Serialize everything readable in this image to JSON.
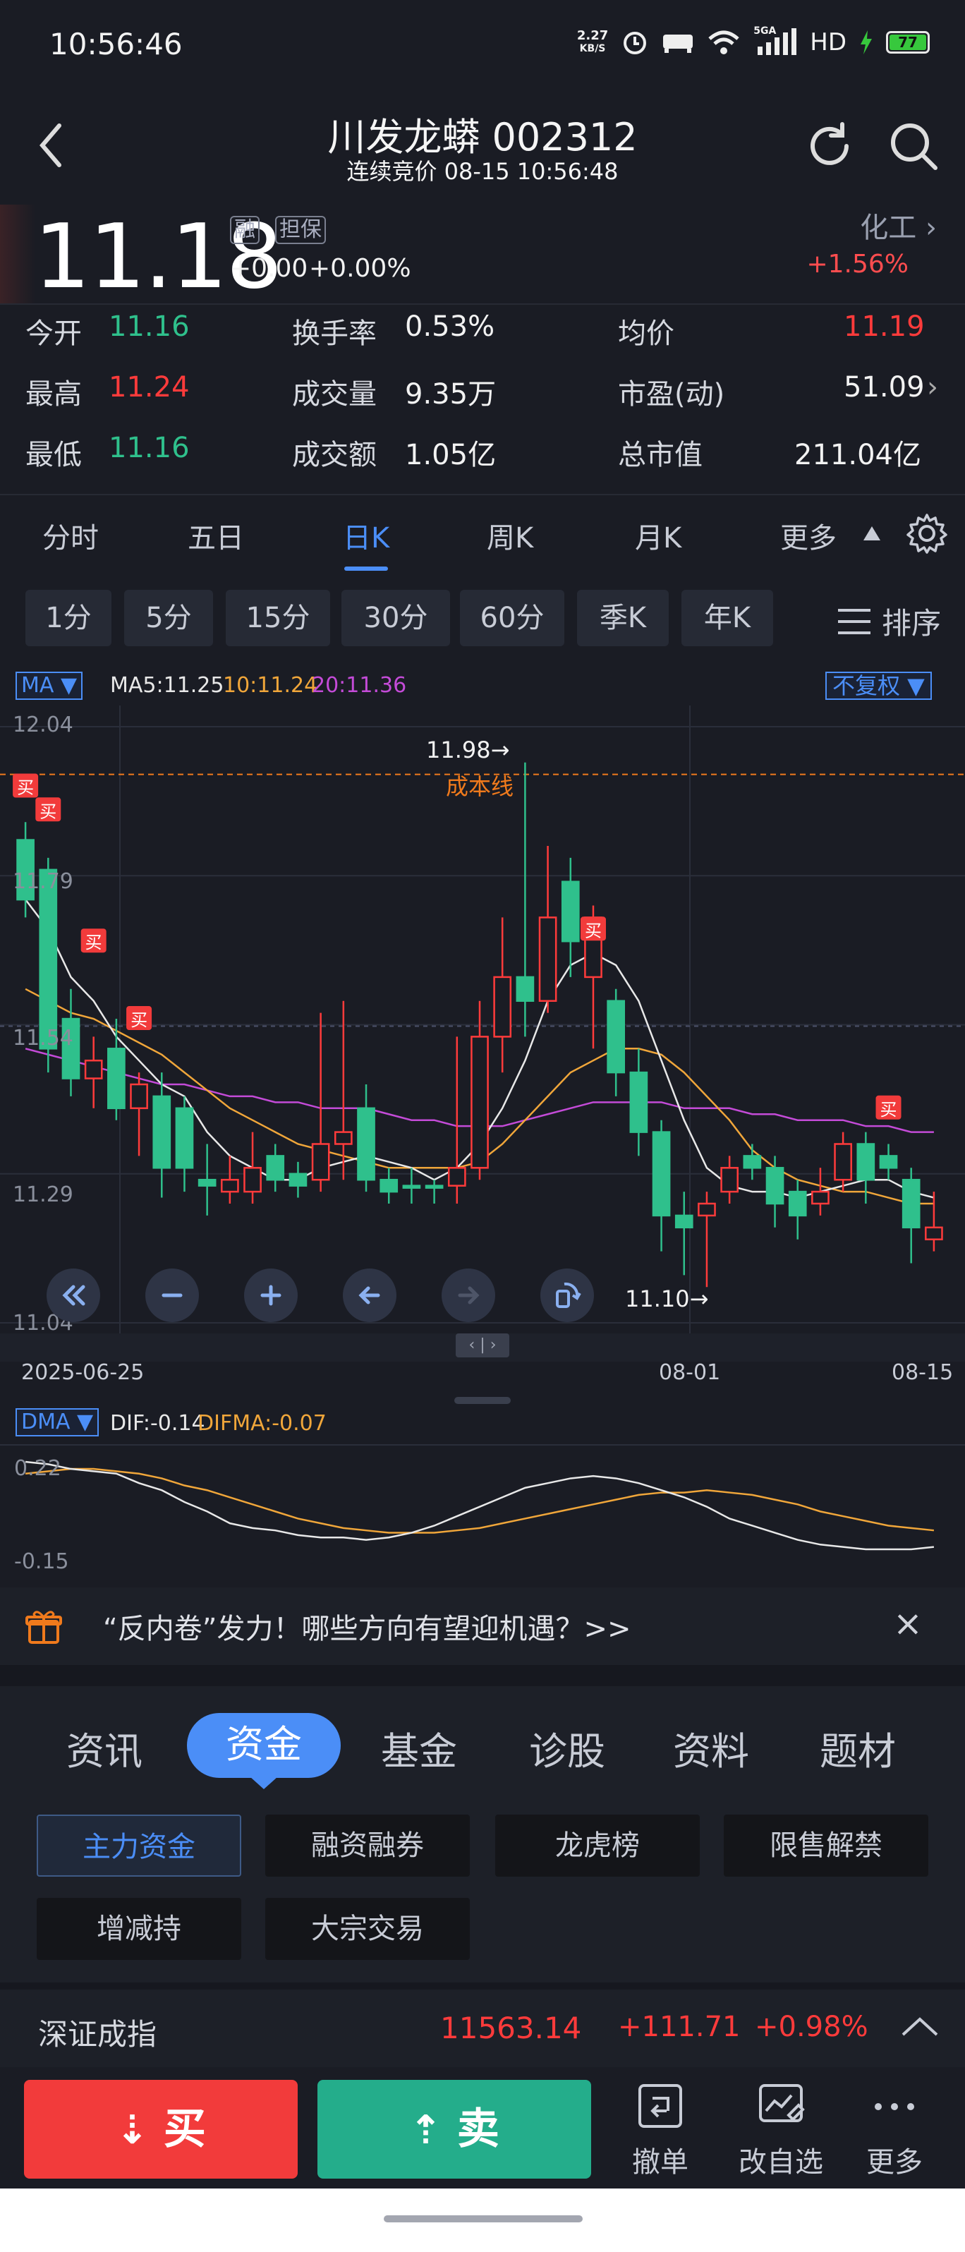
{
  "status": {
    "time": "10:56:46",
    "speed_top": "2.27",
    "speed_bottom": "KB/S",
    "net": "5GA",
    "hd": "HD",
    "battery": "77"
  },
  "header": {
    "title": "川发龙蟒 002312",
    "subtitle": "连续竞价 08-15 10:56:48"
  },
  "quote": {
    "price": "11.18",
    "tag1": "融",
    "tag2": "担保",
    "change": "+0.00",
    "change_pct": "+0.00%",
    "sector": "化工",
    "sector_change": "+1.56%"
  },
  "stats": {
    "open_label": "今开",
    "open": "11.16",
    "turnover_label": "换手率",
    "turnover": "0.53%",
    "avg_label": "均价",
    "avg": "11.19",
    "high_label": "最高",
    "high": "11.24",
    "volume_label": "成交量",
    "volume": "9.35万",
    "pe_label": "市盈(动)",
    "pe": "51.09",
    "low_label": "最低",
    "low": "11.16",
    "amount_label": "成交额",
    "amount": "1.05亿",
    "mcap_label": "总市值",
    "mcap": "211.04亿"
  },
  "period_tabs": [
    "分时",
    "五日",
    "日K",
    "周K",
    "月K",
    "更多"
  ],
  "minute_tabs": [
    "1分",
    "5分",
    "15分",
    "30分",
    "60分",
    "季K",
    "年K"
  ],
  "sort_label": "排序",
  "chart": {
    "ma_label": "MA ▼",
    "ma5": "MA5:11.25",
    "ma10": "10:11.24",
    "ma20": "20:11.36",
    "fq": "不复权 ▼",
    "y_ticks": [
      "12.04",
      "11.79",
      "11.54",
      "11.29",
      "11.04"
    ],
    "high_marker": "11.98→",
    "low_marker": "11.10→",
    "cost_line": "成本线",
    "buy_tag": "买",
    "dates": [
      "2025-06-25",
      "08-01",
      "08-15"
    ],
    "dma_label": "DMA ▼",
    "dif": "DIF:-0.14",
    "difma": "DIFMA:-0.07",
    "dma_ticks": [
      "0.22",
      "-0.15"
    ],
    "colors": {
      "up": "#ff3b3b",
      "down": "#2fc08c",
      "ma5": "#e8e8e8",
      "ma10": "#f0a63a",
      "ma20": "#c44bd8",
      "cost": "#f07a1c"
    }
  },
  "chart_data": {
    "type": "candlestick",
    "ylim": [
      11.04,
      12.04
    ],
    "candles": [
      [
        11.85,
        11.75,
        11.88,
        11.72,
        "down"
      ],
      [
        11.8,
        11.5,
        11.82,
        11.46,
        "down"
      ],
      [
        11.55,
        11.45,
        11.6,
        11.42,
        "down"
      ],
      [
        11.45,
        11.48,
        11.52,
        11.4,
        "up"
      ],
      [
        11.5,
        11.4,
        11.55,
        11.38,
        "down"
      ],
      [
        11.4,
        11.44,
        11.46,
        11.32,
        "up"
      ],
      [
        11.42,
        11.3,
        11.46,
        11.25,
        "down"
      ],
      [
        11.4,
        11.3,
        11.42,
        11.26,
        "down"
      ],
      [
        11.28,
        11.27,
        11.34,
        11.22,
        "down"
      ],
      [
        11.26,
        11.28,
        11.32,
        11.24,
        "up"
      ],
      [
        11.3,
        11.26,
        11.36,
        11.24,
        "up"
      ],
      [
        11.32,
        11.28,
        11.34,
        11.26,
        "down"
      ],
      [
        11.29,
        11.27,
        11.31,
        11.25,
        "down"
      ],
      [
        11.28,
        11.34,
        11.56,
        11.26,
        "up"
      ],
      [
        11.34,
        11.36,
        11.58,
        11.28,
        "up"
      ],
      [
        11.4,
        11.28,
        11.44,
        11.26,
        "down"
      ],
      [
        11.28,
        11.26,
        11.3,
        11.24,
        "down"
      ],
      [
        11.27,
        11.27,
        11.3,
        11.24,
        "down"
      ],
      [
        11.27,
        11.27,
        11.28,
        11.24,
        "down"
      ],
      [
        11.27,
        11.3,
        11.52,
        11.24,
        "up"
      ],
      [
        11.3,
        11.52,
        11.58,
        11.28,
        "up"
      ],
      [
        11.52,
        11.62,
        11.72,
        11.46,
        "up"
      ],
      [
        11.62,
        11.58,
        11.98,
        11.52,
        "down"
      ],
      [
        11.58,
        11.72,
        11.84,
        11.56,
        "up"
      ],
      [
        11.78,
        11.68,
        11.82,
        11.62,
        "down"
      ],
      [
        11.62,
        11.72,
        11.74,
        11.5,
        "up"
      ],
      [
        11.58,
        11.46,
        11.6,
        11.42,
        "down"
      ],
      [
        11.46,
        11.36,
        11.5,
        11.32,
        "down"
      ],
      [
        11.36,
        11.22,
        11.38,
        11.16,
        "down"
      ],
      [
        11.22,
        11.2,
        11.26,
        11.12,
        "down"
      ],
      [
        11.24,
        11.22,
        11.26,
        11.1,
        "up"
      ],
      [
        11.26,
        11.3,
        11.32,
        11.24,
        "up"
      ],
      [
        11.32,
        11.3,
        11.34,
        11.28,
        "down"
      ],
      [
        11.3,
        11.24,
        11.32,
        11.2,
        "down"
      ],
      [
        11.26,
        11.22,
        11.28,
        11.18,
        "down"
      ],
      [
        11.24,
        11.26,
        11.3,
        11.22,
        "up"
      ],
      [
        11.28,
        11.34,
        11.36,
        11.26,
        "up"
      ],
      [
        11.34,
        11.28,
        11.36,
        11.24,
        "down"
      ],
      [
        11.32,
        11.3,
        11.34,
        11.28,
        "down"
      ],
      [
        11.28,
        11.2,
        11.3,
        11.14,
        "down"
      ],
      [
        11.2,
        11.18,
        11.26,
        11.16,
        "up"
      ]
    ],
    "ma5": [
      11.75,
      11.7,
      11.62,
      11.58,
      11.52,
      11.48,
      11.44,
      11.42,
      11.36,
      11.32,
      11.3,
      11.28,
      11.28,
      11.3,
      11.31,
      11.32,
      11.31,
      11.3,
      11.28,
      11.3,
      11.34,
      11.4,
      11.48,
      11.58,
      11.64,
      11.66,
      11.64,
      11.58,
      11.48,
      11.38,
      11.3,
      11.27,
      11.26,
      11.26,
      11.25,
      11.26,
      11.27,
      11.28,
      11.28,
      11.26,
      11.25
    ],
    "ma10": [
      11.6,
      11.58,
      11.56,
      11.55,
      11.53,
      11.51,
      11.49,
      11.46,
      11.43,
      11.4,
      11.38,
      11.36,
      11.34,
      11.33,
      11.32,
      11.31,
      11.3,
      11.3,
      11.3,
      11.3,
      11.31,
      11.34,
      11.38,
      11.42,
      11.46,
      11.48,
      11.5,
      11.5,
      11.49,
      11.46,
      11.42,
      11.38,
      11.33,
      11.3,
      11.28,
      11.27,
      11.26,
      11.26,
      11.25,
      11.24,
      11.24
    ],
    "ma20": [
      11.5,
      11.49,
      11.48,
      11.47,
      11.46,
      11.45,
      11.44,
      11.44,
      11.43,
      11.42,
      11.42,
      11.41,
      11.41,
      11.4,
      11.4,
      11.4,
      11.39,
      11.38,
      11.38,
      11.37,
      11.37,
      11.37,
      11.38,
      11.39,
      11.4,
      11.41,
      11.41,
      11.41,
      11.41,
      11.4,
      11.4,
      11.4,
      11.39,
      11.39,
      11.38,
      11.38,
      11.38,
      11.37,
      11.37,
      11.36,
      11.36
    ],
    "buy_marks": [
      [
        0,
        11.94
      ],
      [
        1,
        11.9
      ],
      [
        3,
        11.68
      ],
      [
        5,
        11.55
      ],
      [
        25,
        11.7
      ],
      [
        38,
        11.4
      ]
    ],
    "dma_dif": [
      0.22,
      0.21,
      0.19,
      0.18,
      0.17,
      0.13,
      0.1,
      0.05,
      0.01,
      -0.04,
      -0.06,
      -0.07,
      -0.09,
      -0.1,
      -0.1,
      -0.11,
      -0.1,
      -0.08,
      -0.05,
      -0.01,
      0.03,
      0.07,
      0.11,
      0.13,
      0.15,
      0.16,
      0.15,
      0.13,
      0.1,
      0.07,
      0.03,
      -0.02,
      -0.05,
      -0.08,
      -0.11,
      -0.13,
      -0.14,
      -0.15,
      -0.15,
      -0.15,
      -0.14
    ],
    "dma_difma": [
      0.17,
      0.18,
      0.19,
      0.19,
      0.18,
      0.17,
      0.15,
      0.12,
      0.1,
      0.07,
      0.04,
      0.01,
      -0.02,
      -0.04,
      -0.06,
      -0.07,
      -0.08,
      -0.08,
      -0.08,
      -0.07,
      -0.06,
      -0.04,
      -0.02,
      0.0,
      0.02,
      0.04,
      0.06,
      0.08,
      0.09,
      0.09,
      0.1,
      0.09,
      0.08,
      0.06,
      0.04,
      0.01,
      -0.01,
      -0.03,
      -0.05,
      -0.06,
      -0.07
    ]
  },
  "banner": {
    "text": "“反内卷”发力！哪些方向有望迎机遇？>>",
    "close": "×"
  },
  "info_tabs": [
    "资讯",
    "资金",
    "基金",
    "诊股",
    "资料",
    "题材"
  ],
  "sub_buttons": [
    "主力资金",
    "融资融券",
    "龙虎榜",
    "限售解禁",
    "增减持",
    "大宗交易"
  ],
  "index_bar": {
    "name": "深证成指",
    "value": "11563.14",
    "change": "+111.71",
    "pct": "+0.98%"
  },
  "bottom": {
    "buy": "买",
    "sell": "卖",
    "withdraw": "撤单",
    "edit": "改自选",
    "more": "更多"
  }
}
